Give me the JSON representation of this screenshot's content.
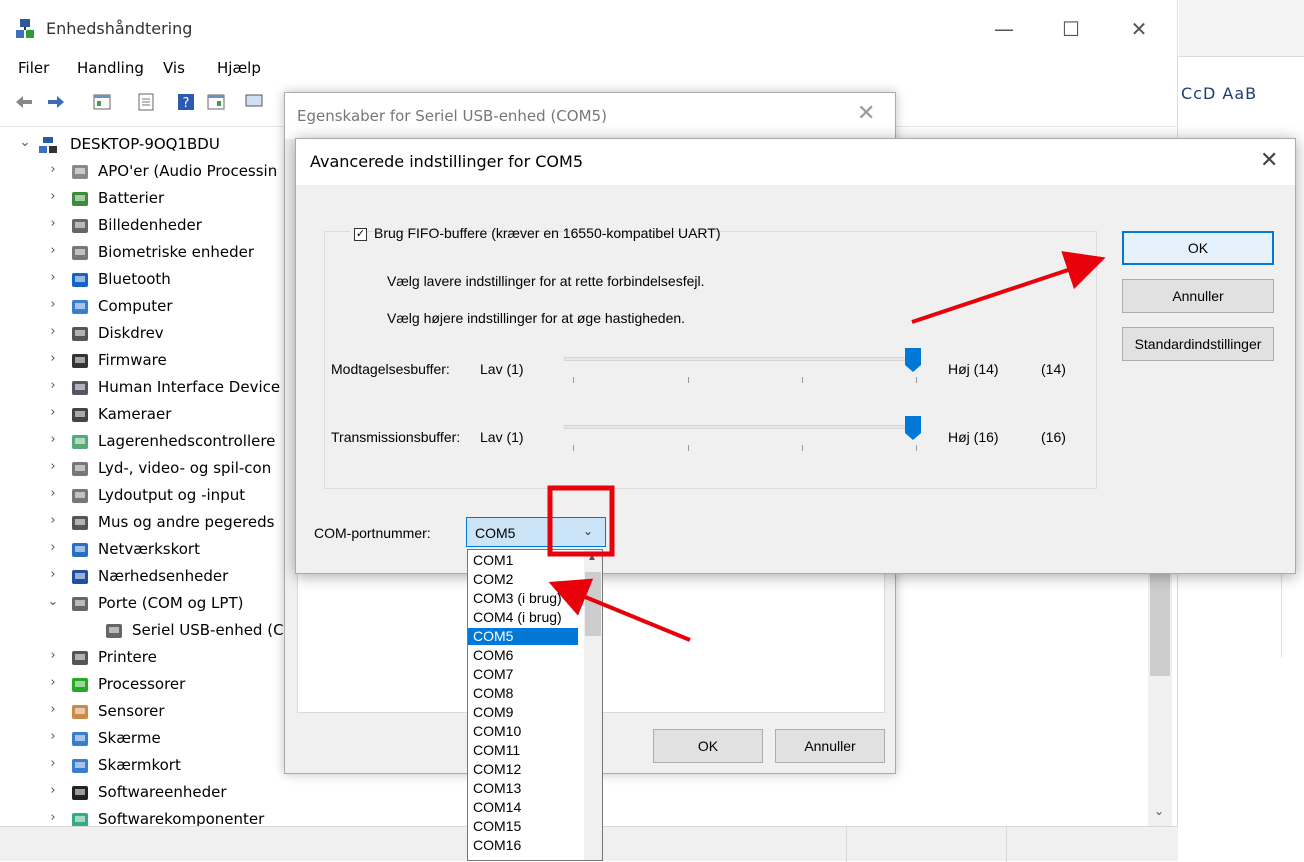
{
  "device_manager": {
    "title": "Enhedshåndtering",
    "window_controls": {
      "minimize": "—",
      "maximize": "☐",
      "close": "✕"
    },
    "menu": [
      "Filer",
      "Handling",
      "Vis",
      "Hjælp"
    ],
    "tree": {
      "root": "DESKTOP-9OQ1BDU",
      "items": [
        {
          "label": "APO'er (Audio Processin",
          "icon": "audio-icon"
        },
        {
          "label": "Batterier",
          "icon": "battery-icon"
        },
        {
          "label": "Billedenheder",
          "icon": "camera-device-icon"
        },
        {
          "label": "Biometriske enheder",
          "icon": "fingerprint-icon"
        },
        {
          "label": "Bluetooth",
          "icon": "bluetooth-icon"
        },
        {
          "label": "Computer",
          "icon": "computer-icon"
        },
        {
          "label": "Diskdrev",
          "icon": "disk-icon"
        },
        {
          "label": "Firmware",
          "icon": "chip-icon"
        },
        {
          "label": "Human Interface Device",
          "icon": "hid-icon"
        },
        {
          "label": "Kameraer",
          "icon": "webcam-icon"
        },
        {
          "label": "Lagerenhedscontrollere",
          "icon": "storage-controller-icon"
        },
        {
          "label": "Lyd-, video- og spil-con",
          "icon": "speaker-icon"
        },
        {
          "label": "Lydoutput og -input",
          "icon": "speaker-icon"
        },
        {
          "label": "Mus og andre pegereds",
          "icon": "mouse-icon"
        },
        {
          "label": "Netværkskort",
          "icon": "network-icon"
        },
        {
          "label": "Nærhedsenheder",
          "icon": "proximity-icon"
        },
        {
          "label": "Porte (COM og LPT)",
          "icon": "port-icon",
          "expanded": true
        },
        {
          "label": "Seriel USB-enhed (C",
          "icon": "port-icon",
          "child": true
        },
        {
          "label": "Printere",
          "icon": "printer-icon"
        },
        {
          "label": "Processorer",
          "icon": "processor-icon"
        },
        {
          "label": "Sensorer",
          "icon": "sensor-icon"
        },
        {
          "label": "Skærme",
          "icon": "monitor-icon"
        },
        {
          "label": "Skærmkort",
          "icon": "display-adapter-icon"
        },
        {
          "label": "Softwareenheder",
          "icon": "software-device-icon"
        },
        {
          "label": "Softwarekomponenter",
          "icon": "software-component-icon"
        }
      ]
    }
  },
  "right_window": {
    "style_text": "CcD AaB"
  },
  "properties_dialog": {
    "title": "Egenskaber for Seriel USB-enhed (COM5)",
    "ok_label": "OK",
    "cancel_label": "Annuller"
  },
  "advanced_dialog": {
    "title": "Avancerede indstillinger for COM5",
    "fifo_label": "Brug FIFO-buffere (kræver en 16550-kompatibel UART)",
    "fifo_checked": true,
    "hint_lower": "Vælg lavere indstillinger for at rette forbindelsesfejl.",
    "hint_higher": "Vælg højere indstillinger for at øge hastigheden.",
    "receive": {
      "label": "Modtagelsesbuffer:",
      "low": "Lav (1)",
      "high": "Høj (14)",
      "value_text": "(14)",
      "value": 14,
      "max": 14
    },
    "transmit": {
      "label": "Transmissionsbuffer:",
      "low": "Lav (1)",
      "high": "Høj (16)",
      "value_text": "(16)",
      "value": 16,
      "max": 16
    },
    "com_label": "COM-portnummer:",
    "com_selected": "COM5",
    "buttons": {
      "ok": "OK",
      "cancel": "Annuller",
      "defaults": "Standardindstillinger"
    }
  },
  "dropdown": {
    "options": [
      "COM1",
      "COM2",
      "COM3 (i brug)",
      "COM4 (i brug)",
      "COM5",
      "COM6",
      "COM7",
      "COM8",
      "COM9",
      "COM10",
      "COM11",
      "COM12",
      "COM13",
      "COM14",
      "COM15",
      "COM16"
    ],
    "selected_index": 4
  },
  "colors": {
    "accent": "#0078d7",
    "annotation": "#e8000b"
  }
}
